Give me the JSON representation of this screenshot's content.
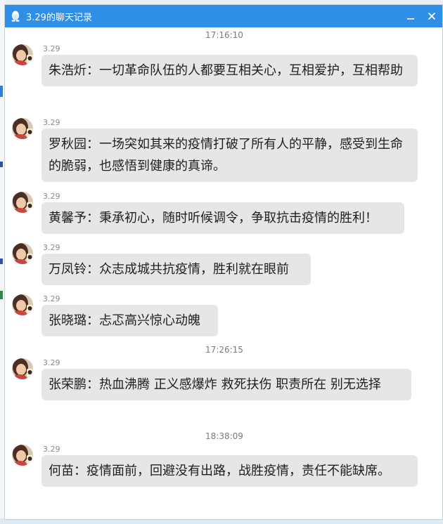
{
  "window": {
    "title": "3.29的聊天记录"
  },
  "messages": [
    {
      "time": "17:16:10",
      "sender": "3.29",
      "text": "朱浩炘：一切革命队伍的人都要互相关心，互相爱护，互相帮助"
    },
    {
      "sender": "3.29",
      "text": "罗秋园：一场突如其来的疫情打破了所有人的平静，感受到生命的脆弱，也感悟到健康的真谛。"
    },
    {
      "sender": "3.29",
      "text": "黄馨予：秉承初心，随时听候调令，争取抗击疫情的胜利！"
    },
    {
      "sender": "3.29",
      "text": "万凤铃：众志成城共抗疫情，胜利就在眼前"
    },
    {
      "sender": "3.29",
      "text": "张晓璐：忐忑高兴惊心动魄"
    },
    {
      "time": "17:26:15",
      "sender": "3.29",
      "text": "张荣鹏：热血沸腾 正义感爆炸 救死扶伤 职责所在 别无选择"
    },
    {
      "time": "18:38:09",
      "sender": "3.29",
      "text": "何苗：疫情面前，回避没有出路，战胜疫情，责任不能缺席。"
    }
  ],
  "colors": {
    "titlebar": "#2f8ee6",
    "bubble": "#e6e6e6"
  },
  "icons": {
    "app": "qq-penguin-icon",
    "minimize": "minimize-icon",
    "close": "close-icon"
  }
}
